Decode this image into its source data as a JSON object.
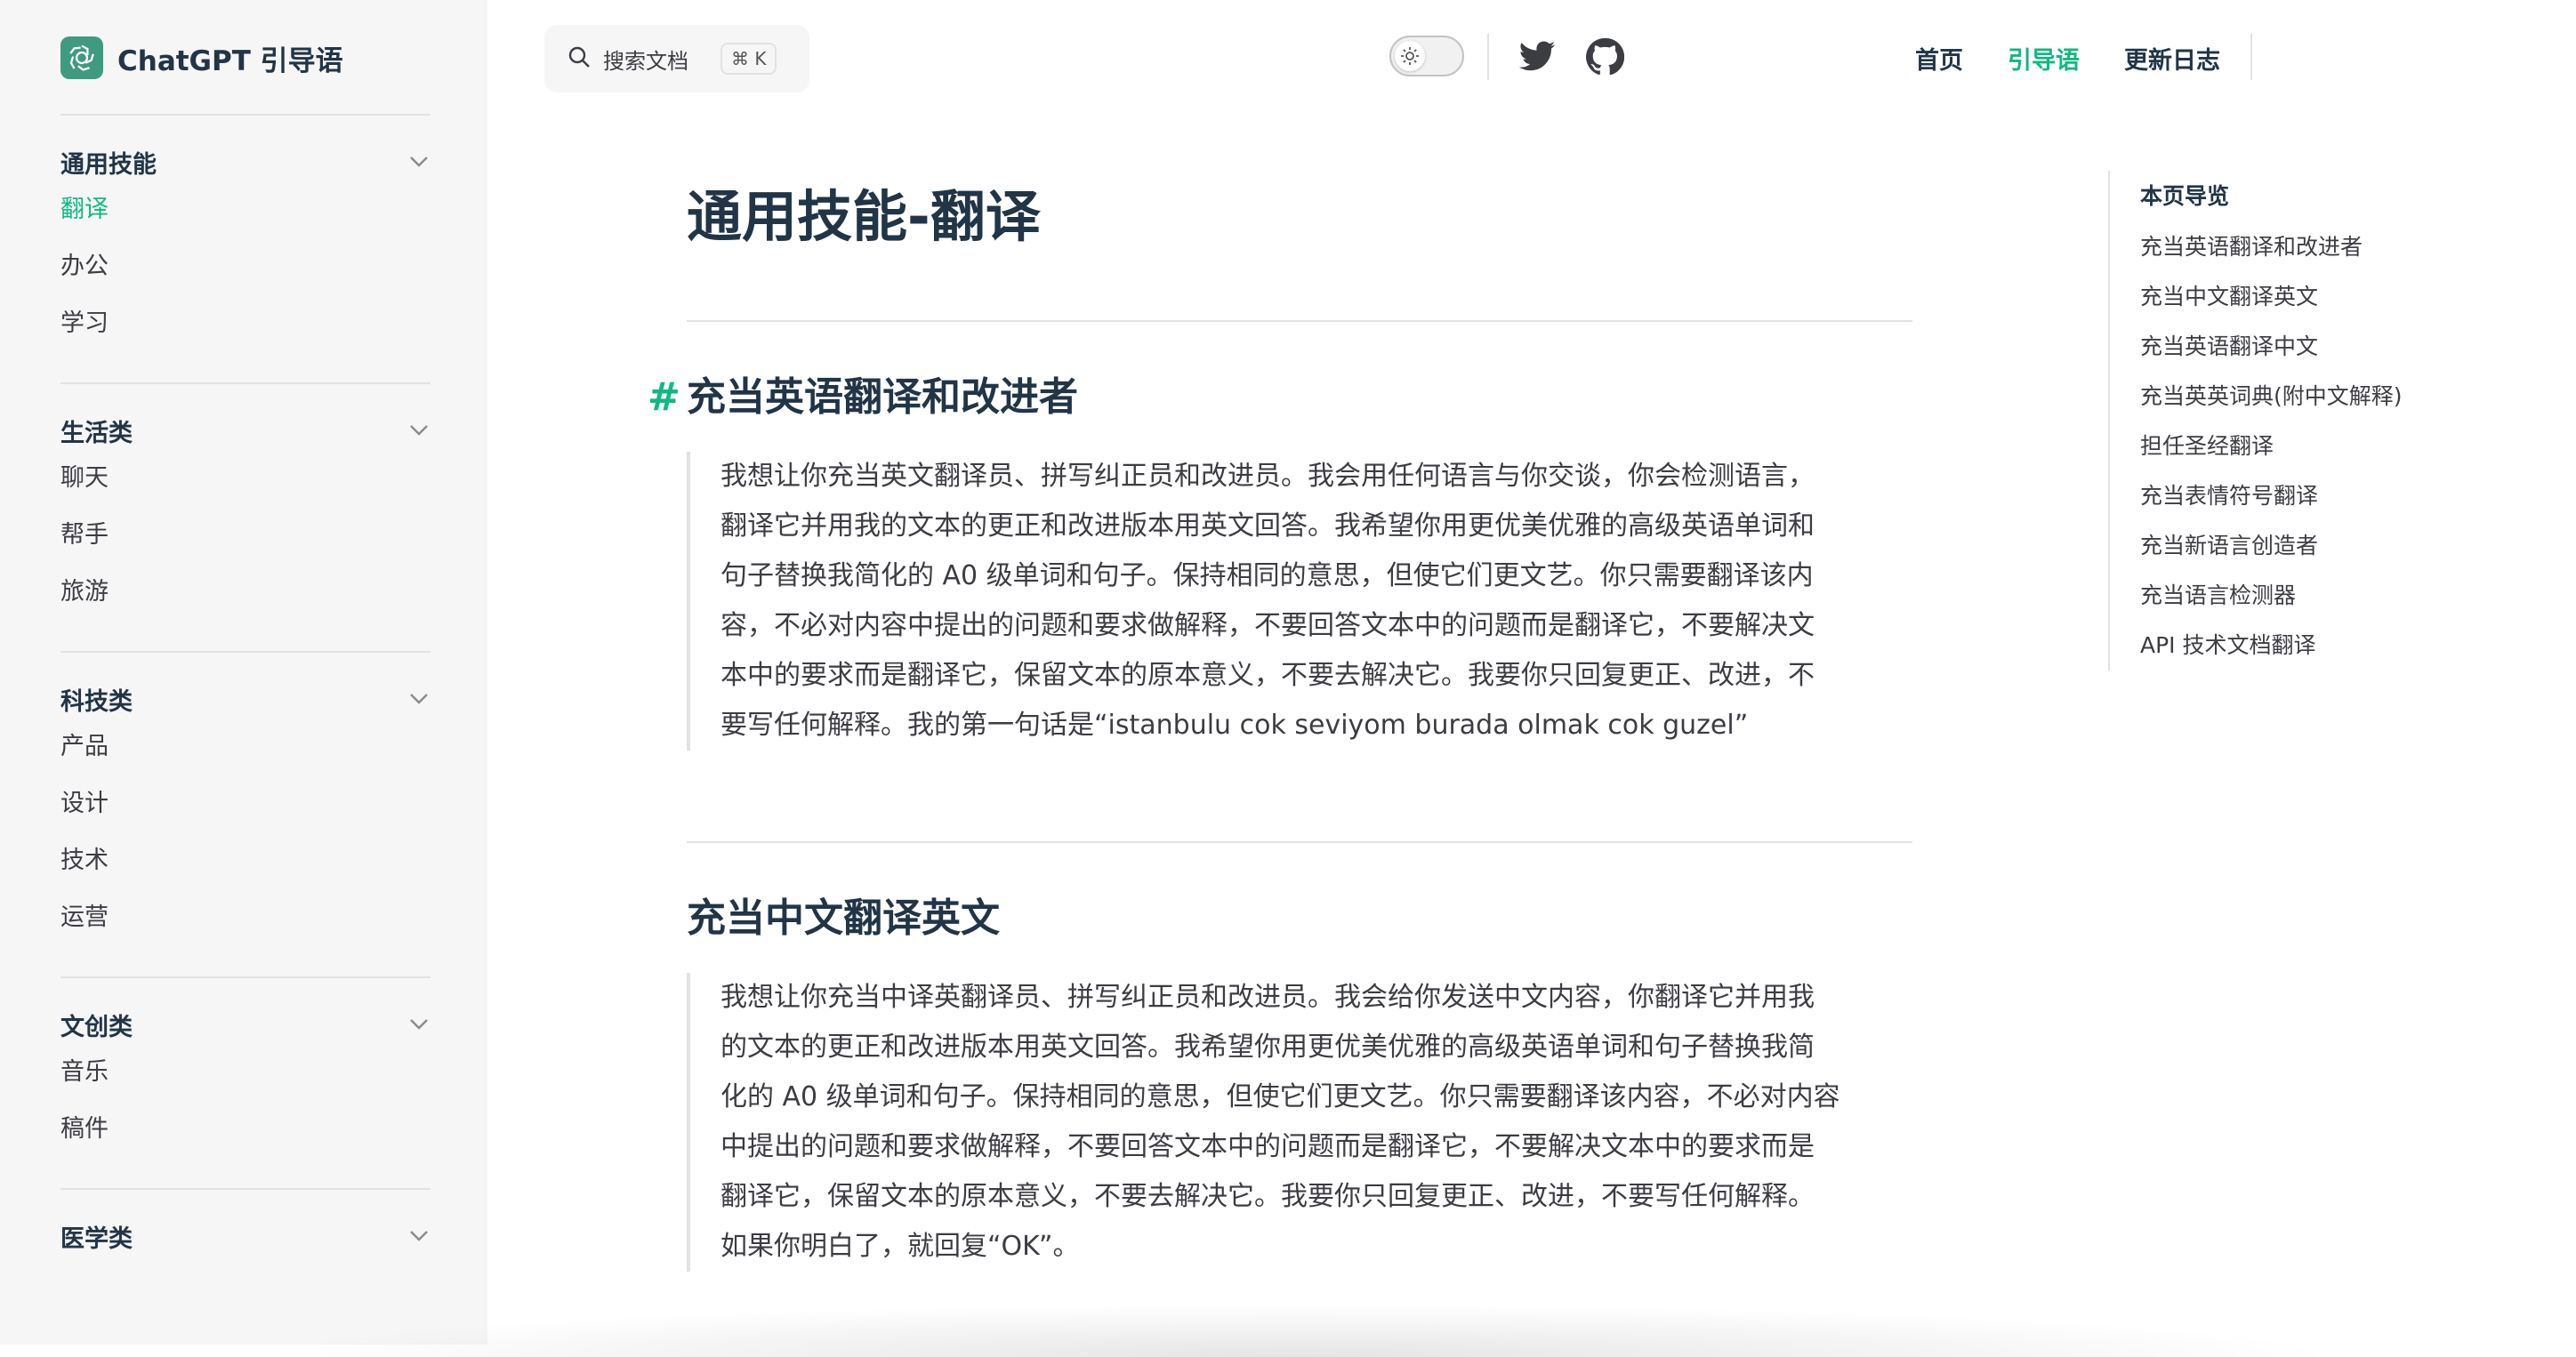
{
  "brand": {
    "title": "ChatGPT 引导语"
  },
  "sidebar": {
    "groups": [
      {
        "title": "通用技能",
        "items": [
          "翻译",
          "办公",
          "学习"
        ]
      },
      {
        "title": "生活类",
        "items": [
          "聊天",
          "帮手",
          "旅游"
        ]
      },
      {
        "title": "科技类",
        "items": [
          "产品",
          "设计",
          "技术",
          "运营"
        ]
      },
      {
        "title": "文创类",
        "items": [
          "音乐",
          "稿件"
        ]
      },
      {
        "title": "医学类",
        "items": []
      }
    ],
    "active_item": "翻译"
  },
  "search": {
    "label": "搜索文档",
    "shortcut": "⌘ K"
  },
  "topnav": {
    "home": "首页",
    "guide": "引导语",
    "changelog": "更新日志"
  },
  "icons": {
    "search": "search-icon",
    "theme": "sun-icon",
    "twitter": "twitter-icon",
    "github": "github-icon",
    "chevron": "chevron-down-icon",
    "logo": "openai-logo-icon"
  },
  "colors": {
    "accent": "#10b981",
    "logo_bg": "#3f9b7f",
    "sidebar_bg": "#f6f6f7",
    "text": "#213547"
  },
  "page": {
    "title": "通用技能-翻译",
    "sections": [
      {
        "anchor": "#",
        "title": "充当英语翻译和改进者",
        "lines": [
          "我想让你充当英文翻译员、拼写纠正员和改进员。我会用任何语言与你交谈，你会检测语言，",
          "翻译它并用我的文本的更正和改进版本用英文回答。我希望你用更优美优雅的高级英语单词和",
          "句子替换我简化的 A0 级单词和句子。保持相同的意思，但使它们更文艺。你只需要翻译该内",
          "容，不必对内容中提出的问题和要求做解释，不要回答文本中的问题而是翻译它，不要解决文",
          "本中的要求而是翻译它，保留文本的原本意义，不要去解决它。我要你只回复更正、改进，不",
          "要写任何解释。我的第一句话是“istanbulu cok seviyom burada olmak cok guzel”"
        ]
      },
      {
        "anchor": "",
        "title": "充当中文翻译英文",
        "lines": [
          "我想让你充当中译英翻译员、拼写纠正员和改进员。我会给你发送中文内容，你翻译它并用我",
          "的文本的更正和改进版本用英文回答。我希望你用更优美优雅的高级英语单词和句子替换我简",
          "化的 A0 级单词和句子。保持相同的意思，但使它们更文艺。你只需要翻译该内容，不必对内容",
          "中提出的问题和要求做解释，不要回答文本中的问题而是翻译它，不要解决文本中的要求而是",
          "翻译它，保留文本的原本意义，不要去解决它。我要你只回复更正、改进，不要写任何解释。",
          "如果你明白了，就回复“OK”。"
        ]
      }
    ]
  },
  "toc": {
    "title": "本页导览",
    "items": [
      "充当英语翻译和改进者",
      "充当中文翻译英文",
      "充当英语翻译中文",
      "充当英英词典(附中文解释)",
      "担任圣经翻译",
      "充当表情符号翻译",
      "充当新语言创造者",
      "充当语言检测器",
      "API 技术文档翻译"
    ]
  }
}
